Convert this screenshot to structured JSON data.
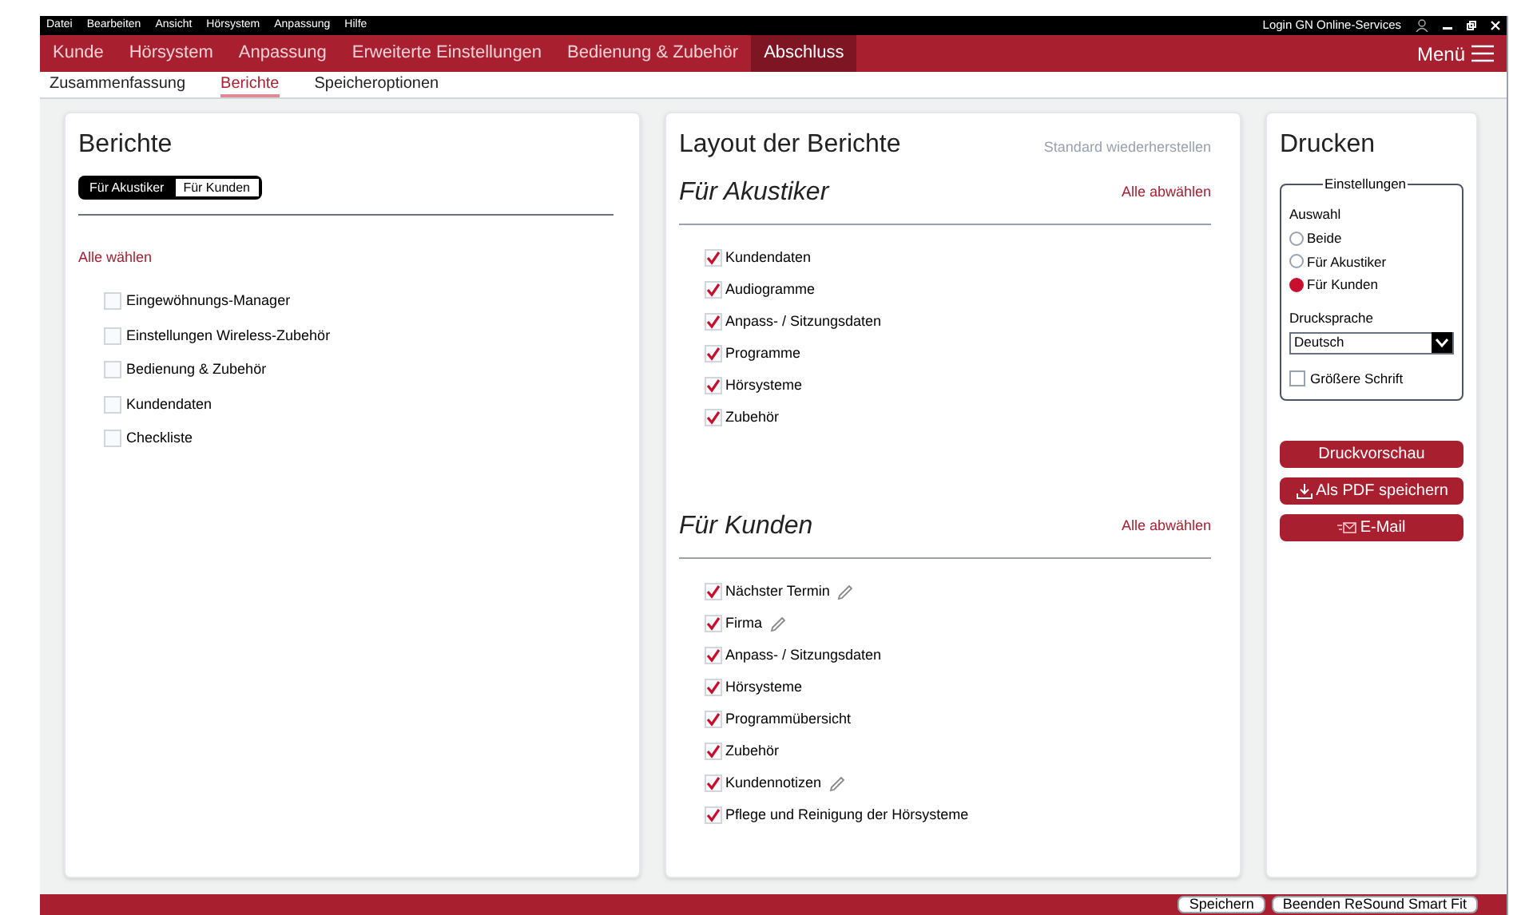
{
  "menu_bar": {
    "items": [
      "Datei",
      "Bearbeiten",
      "Ansicht",
      "Hörsystem",
      "Anpassung",
      "Hilfe"
    ],
    "login": "Login GN Online-Services"
  },
  "main_tabs": [
    {
      "label": "Kunde",
      "selected": false
    },
    {
      "label": "Hörsystem",
      "selected": false
    },
    {
      "label": "Anpassung",
      "selected": false
    },
    {
      "label": "Erweiterte Einstellungen",
      "selected": false
    },
    {
      "label": "Bedienung & Zubehör",
      "selected": false
    },
    {
      "label": "Abschluss",
      "selected": true
    }
  ],
  "menu_button": "Menü",
  "sub_tabs": [
    {
      "label": "Zusammenfassung",
      "selected": false
    },
    {
      "label": "Berichte",
      "selected": true
    },
    {
      "label": "Speicheroptionen",
      "selected": false
    }
  ],
  "reports": {
    "title": "Berichte",
    "toggle": [
      {
        "label": "Für Akustiker",
        "selected": false
      },
      {
        "label": "Für Kunden",
        "selected": true
      }
    ],
    "select_all": "Alle wählen",
    "items": [
      {
        "label": "Eingewöhnungs-Manager",
        "checked": false
      },
      {
        "label": "Einstellungen Wireless-Zubehör",
        "checked": false
      },
      {
        "label": "Bedienung & Zubehör",
        "checked": false
      },
      {
        "label": "Kundendaten",
        "checked": false
      },
      {
        "label": "Checkliste",
        "checked": false
      }
    ]
  },
  "layout": {
    "title": "Layout der Berichte",
    "reset": "Standard wiederherstellen",
    "sections": [
      {
        "title": "Für Akustiker",
        "deselect_all": "Alle abwählen",
        "items": [
          {
            "label": "Kundendaten",
            "checked": true,
            "editable": false
          },
          {
            "label": "Audiogramme",
            "checked": true,
            "editable": false
          },
          {
            "label": "Anpass- / Sitzungsdaten",
            "checked": true,
            "editable": false
          },
          {
            "label": "Programme",
            "checked": true,
            "editable": false
          },
          {
            "label": "Hörsysteme",
            "checked": true,
            "editable": false
          },
          {
            "label": "Zubehör",
            "checked": true,
            "editable": false
          }
        ]
      },
      {
        "title": "Für Kunden",
        "deselect_all": "Alle abwählen",
        "items": [
          {
            "label": "Nächster Termin",
            "checked": true,
            "editable": true
          },
          {
            "label": "Firma",
            "checked": true,
            "editable": true
          },
          {
            "label": "Anpass- / Sitzungsdaten",
            "checked": true,
            "editable": false
          },
          {
            "label": "Hörsysteme",
            "checked": true,
            "editable": false
          },
          {
            "label": "Programmübersicht",
            "checked": true,
            "editable": false
          },
          {
            "label": "Zubehör",
            "checked": true,
            "editable": false
          },
          {
            "label": "Kundennotizen",
            "checked": true,
            "editable": true
          },
          {
            "label": "Pflege und Reinigung der Hörsysteme",
            "checked": true,
            "editable": false
          }
        ]
      }
    ]
  },
  "print": {
    "title": "Drucken",
    "settings_legend": "Einstellungen",
    "selection_label": "Auswahl",
    "options": [
      {
        "label": "Beide",
        "selected": false
      },
      {
        "label": "Für Akustiker",
        "selected": false
      },
      {
        "label": "Für Kunden",
        "selected": true
      }
    ],
    "language_label": "Drucksprache",
    "language": "Deutsch",
    "larger_font": {
      "label": "Größere Schrift",
      "checked": false
    },
    "buttons": [
      {
        "label": "Druckvorschau",
        "kind": "plain"
      },
      {
        "label": "Als PDF speichern",
        "kind": "download"
      },
      {
        "label": "E-Mail",
        "kind": "mail"
      }
    ]
  },
  "footer_buttons": [
    "Speichern",
    "Beenden ReSound Smart Fit"
  ]
}
